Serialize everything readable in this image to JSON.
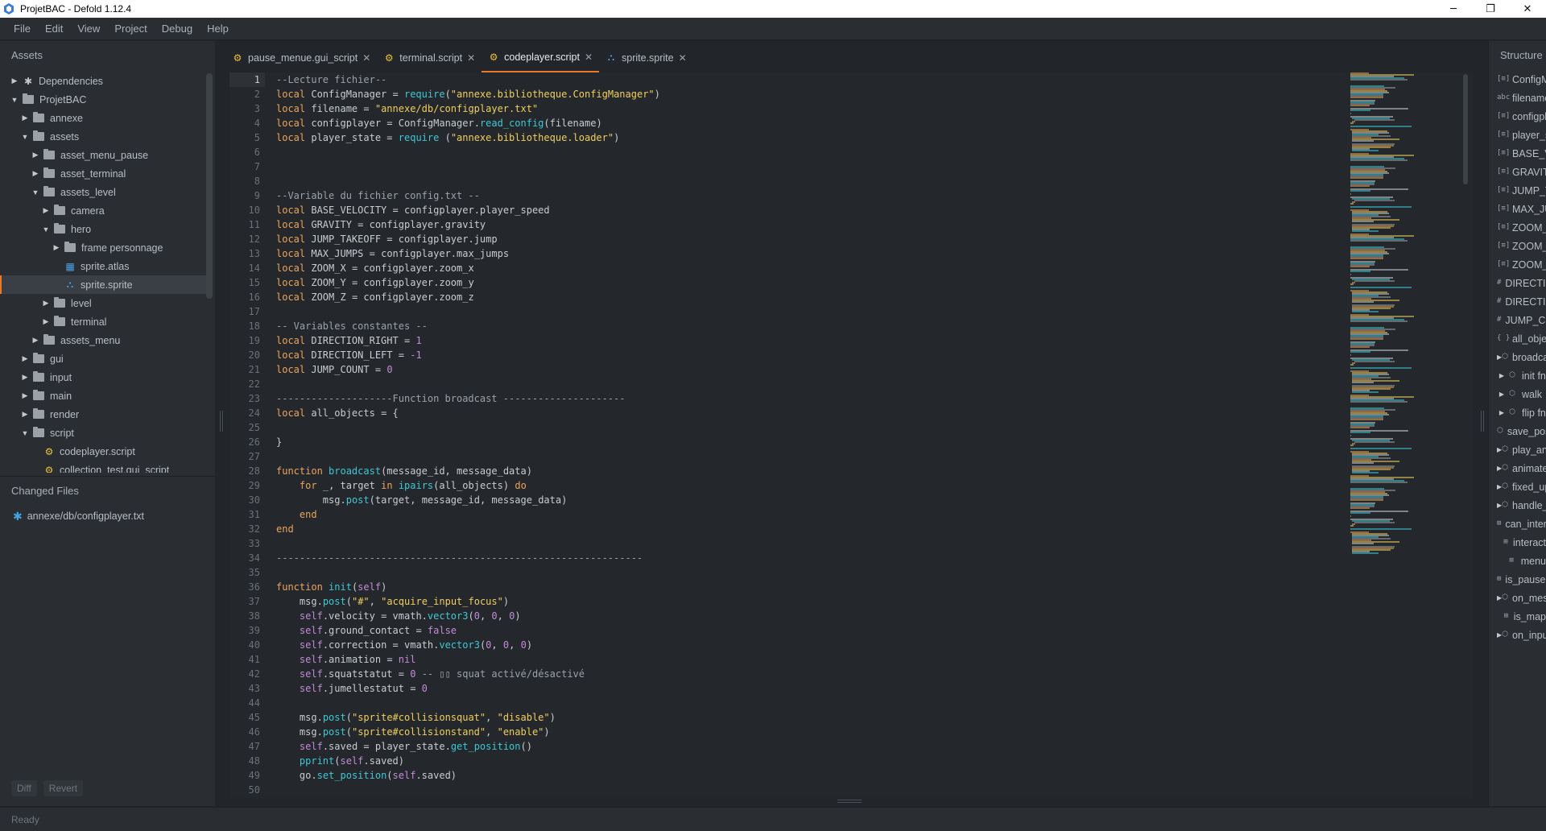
{
  "window": {
    "title": "ProjetBAC - Defold 1.12.4",
    "minimize": "─",
    "maximize": "❐",
    "close": "✕"
  },
  "menubar": [
    "File",
    "Edit",
    "View",
    "Project",
    "Debug",
    "Help"
  ],
  "assets_panel": {
    "title": "Assets",
    "tree": [
      {
        "label": "Dependencies",
        "depth": 0,
        "arrow": "right",
        "icon": "dependencies-icon"
      },
      {
        "label": "ProjetBAC",
        "depth": 0,
        "arrow": "down",
        "icon": "folder-icon"
      },
      {
        "label": "annexe",
        "depth": 1,
        "arrow": "right",
        "icon": "folder-icon"
      },
      {
        "label": "assets",
        "depth": 1,
        "arrow": "down",
        "icon": "folder-icon"
      },
      {
        "label": "asset_menu_pause",
        "depth": 2,
        "arrow": "right",
        "icon": "folder-icon"
      },
      {
        "label": "asset_terminal",
        "depth": 2,
        "arrow": "right",
        "icon": "folder-icon"
      },
      {
        "label": "assets_level",
        "depth": 2,
        "arrow": "down",
        "icon": "folder-icon"
      },
      {
        "label": "camera",
        "depth": 3,
        "arrow": "right",
        "icon": "folder-icon"
      },
      {
        "label": "hero",
        "depth": 3,
        "arrow": "down",
        "icon": "folder-icon"
      },
      {
        "label": "frame personnage",
        "depth": 4,
        "arrow": "right",
        "icon": "folder-icon"
      },
      {
        "label": "sprite.atlas",
        "depth": 4,
        "arrow": "none",
        "icon": "atlas-icon"
      },
      {
        "label": "sprite.sprite",
        "depth": 4,
        "arrow": "none",
        "icon": "sprite-icon",
        "selected": true
      },
      {
        "label": "level",
        "depth": 3,
        "arrow": "right",
        "icon": "folder-icon"
      },
      {
        "label": "terminal",
        "depth": 3,
        "arrow": "right",
        "icon": "folder-icon"
      },
      {
        "label": "assets_menu",
        "depth": 2,
        "arrow": "right",
        "icon": "folder-icon"
      },
      {
        "label": "gui",
        "depth": 1,
        "arrow": "right",
        "icon": "folder-icon"
      },
      {
        "label": "input",
        "depth": 1,
        "arrow": "right",
        "icon": "folder-icon"
      },
      {
        "label": "main",
        "depth": 1,
        "arrow": "right",
        "icon": "folder-icon"
      },
      {
        "label": "render",
        "depth": 1,
        "arrow": "right",
        "icon": "folder-icon"
      },
      {
        "label": "script",
        "depth": 1,
        "arrow": "down",
        "icon": "folder-icon"
      },
      {
        "label": "codeplayer.script",
        "depth": 2,
        "arrow": "none",
        "icon": "script-icon"
      },
      {
        "label": "collection_test.gui_script",
        "depth": 2,
        "arrow": "none",
        "icon": "script-icon"
      }
    ]
  },
  "changed_files": {
    "title": "Changed Files",
    "items": [
      {
        "label": "annexe/db/configplayer.txt",
        "icon": "modified-icon"
      }
    ],
    "diff_label": "Diff",
    "revert_label": "Revert"
  },
  "statusbar": {
    "text": "Ready"
  },
  "tabs": [
    {
      "label": "pause_menue.gui_script",
      "icon": "script-icon",
      "active": false
    },
    {
      "label": "terminal.script",
      "icon": "script-icon",
      "active": false
    },
    {
      "label": "codeplayer.script",
      "icon": "script-icon",
      "active": true
    },
    {
      "label": "sprite.sprite",
      "icon": "sprite-icon",
      "active": false
    }
  ],
  "editor": {
    "current_line": 1,
    "lines": [
      "--Lecture fichier--",
      "local ConfigManager = require(\"annexe.bibliotheque.ConfigManager\")",
      "local filename = \"annexe/db/configplayer.txt\"",
      "local configplayer = ConfigManager.read_config(filename)",
      "local player_state = require (\"annexe.bibliotheque.loader\")",
      "",
      "",
      "",
      "--Variable du fichier config.txt --",
      "local BASE_VELOCITY = configplayer.player_speed",
      "local GRAVITY = configplayer.gravity",
      "local JUMP_TAKEOFF = configplayer.jump",
      "local MAX_JUMPS = configplayer.max_jumps",
      "local ZOOM_X = configplayer.zoom_x",
      "local ZOOM_Y = configplayer.zoom_y",
      "local ZOOM_Z = configplayer.zoom_z",
      "",
      "-- Variables constantes --",
      "local DIRECTION_RIGHT = 1",
      "local DIRECTION_LEFT = -1",
      "local JUMP_COUNT = 0",
      "",
      "--------------------Function broadcast ---------------------",
      "local all_objects = {",
      "",
      "}",
      "",
      "function broadcast(message_id, message_data)",
      "    for _, target in ipairs(all_objects) do",
      "        msg.post(target, message_id, message_data)",
      "    end",
      "end",
      "",
      "---------------------------------------------------------------",
      "",
      "function init(self)",
      "    msg.post(\"#\", \"acquire_input_focus\")",
      "    self.velocity = vmath.vector3(0, 0, 0)",
      "    self.ground_contact = false",
      "    self.correction = vmath.vector3(0, 0, 0)",
      "    self.animation = nil",
      "    self.squatstatut = 0 -- ▯▯ squat activé/désactivé",
      "    self.jumellestatut = 0",
      "",
      "    msg.post(\"sprite#collisionsquat\", \"disable\")",
      "    msg.post(\"sprite#collisionstand\", \"enable\")",
      "    self.saved = player_state.get_position()",
      "    pprint(self.saved)",
      "    go.set_position(self.saved)",
      ""
    ]
  },
  "colors": {
    "keyword": "#e9a45b",
    "string": "#f1ce5e",
    "comment": "#9ba1a7",
    "function": "#3fc7d4",
    "self": "#c48ad8",
    "number": "#e9a45b",
    "text": "#c8cdd2",
    "accent": "#e8792b"
  },
  "structure_panel": {
    "title": "Structure",
    "items": [
      {
        "label": "ConfigManager",
        "icon": "[≡]",
        "arrow": false
      },
      {
        "label": "filename",
        "icon": "abc",
        "arrow": false
      },
      {
        "label": "configplayer",
        "icon": "[≡]",
        "arrow": false
      },
      {
        "label": "player_state",
        "icon": "[≡]",
        "arrow": false
      },
      {
        "label": "BASE_VELOCITY",
        "icon": "[≡]",
        "arrow": false
      },
      {
        "label": "GRAVITY",
        "icon": "[≡]",
        "arrow": false
      },
      {
        "label": "JUMP_TAKEOFF",
        "icon": "[≡]",
        "arrow": false
      },
      {
        "label": "MAX_JUMPS",
        "icon": "[≡]",
        "arrow": false
      },
      {
        "label": "ZOOM_X",
        "icon": "[≡]",
        "arrow": false
      },
      {
        "label": "ZOOM_Y",
        "icon": "[≡]",
        "arrow": false
      },
      {
        "label": "ZOOM_Z",
        "icon": "[≡]",
        "arrow": false
      },
      {
        "label": "DIRECTION_RIGHT",
        "icon": "#",
        "arrow": false
      },
      {
        "label": "DIRECTION_LEFT",
        "icon": "#",
        "arrow": false
      },
      {
        "label": "JUMP_COUNT",
        "icon": "#",
        "arrow": false
      },
      {
        "label": "all_objects",
        "icon": "{ }",
        "arrow": false
      },
      {
        "label": "broadcast",
        "icon": "⬡",
        "arrow": true
      },
      {
        "label": "init fn",
        "icon": "⬡",
        "arrow": true
      },
      {
        "label": "walk",
        "icon": "⬡",
        "arrow": true
      },
      {
        "label": "flip fn",
        "icon": "⬡",
        "arrow": true
      },
      {
        "label": "save_position",
        "icon": "⬡",
        "arrow": false
      },
      {
        "label": "play_animation",
        "icon": "⬡",
        "arrow": true
      },
      {
        "label": "animate",
        "icon": "⬡",
        "arrow": true
      },
      {
        "label": "fixed_update",
        "icon": "⬡",
        "arrow": true
      },
      {
        "label": "handle_geometry",
        "icon": "⬡",
        "arrow": true
      },
      {
        "label": "can_interact",
        "icon": "⊞",
        "arrow": false
      },
      {
        "label": "interact",
        "icon": "⊞",
        "arrow": false
      },
      {
        "label": "menu",
        "icon": "⊞",
        "arrow": false
      },
      {
        "label": "is_paused",
        "icon": "⊞",
        "arrow": false
      },
      {
        "label": "on_message",
        "icon": "⬡",
        "arrow": true
      },
      {
        "label": "is_map",
        "icon": "⊞",
        "arrow": false
      },
      {
        "label": "on_input",
        "icon": "⬡",
        "arrow": true
      }
    ]
  }
}
